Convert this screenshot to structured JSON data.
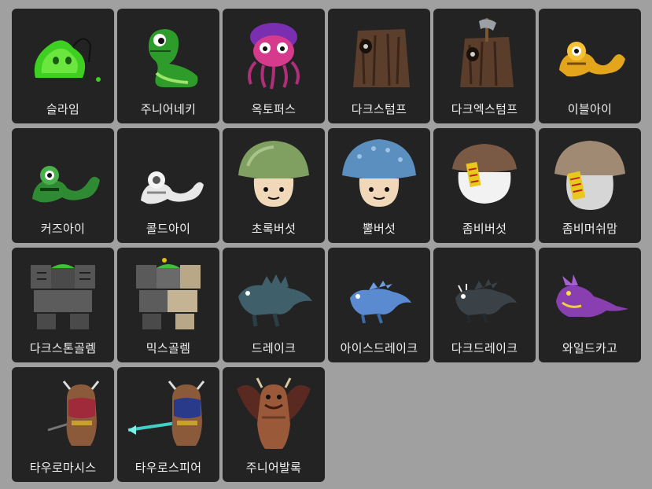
{
  "monsters": [
    {
      "name": "슬라임",
      "icon": "slime-icon"
    },
    {
      "name": "주니어네키",
      "icon": "junior-neki-icon"
    },
    {
      "name": "옥토퍼스",
      "icon": "octopus-icon"
    },
    {
      "name": "다크스텀프",
      "icon": "dark-stump-icon"
    },
    {
      "name": "다크엑스텀프",
      "icon": "dark-axe-stump-icon"
    },
    {
      "name": "이블아이",
      "icon": "evil-eye-icon"
    },
    {
      "name": "커즈아이",
      "icon": "curse-eye-icon"
    },
    {
      "name": "콜드아이",
      "icon": "cold-eye-icon"
    },
    {
      "name": "초록버섯",
      "icon": "green-mushroom-icon"
    },
    {
      "name": "뿔버섯",
      "icon": "horny-mushroom-icon"
    },
    {
      "name": "좀비버섯",
      "icon": "zombie-mushroom-icon"
    },
    {
      "name": "좀비머쉬맘",
      "icon": "zombie-mushmom-icon"
    },
    {
      "name": "다크스톤골렘",
      "icon": "dark-stone-golem-icon"
    },
    {
      "name": "믹스골렘",
      "icon": "mixed-golem-icon"
    },
    {
      "name": "드레이크",
      "icon": "drake-icon"
    },
    {
      "name": "아이스드레이크",
      "icon": "ice-drake-icon"
    },
    {
      "name": "다크드레이크",
      "icon": "dark-drake-icon"
    },
    {
      "name": "와일드카고",
      "icon": "wild-kargo-icon"
    },
    {
      "name": "타우로마시스",
      "icon": "tauromacis-icon"
    },
    {
      "name": "타우로스피어",
      "icon": "taurospear-icon"
    },
    {
      "name": "주니어발록",
      "icon": "junior-balrog-icon"
    }
  ]
}
